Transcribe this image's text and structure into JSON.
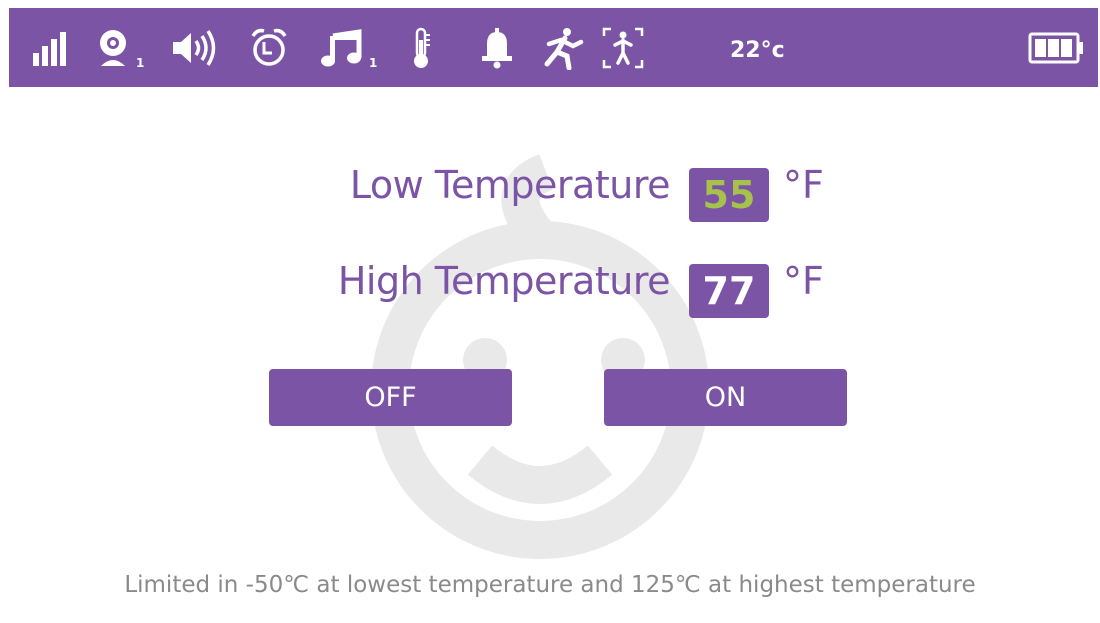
{
  "status_bar": {
    "icons": [
      "signal-icon",
      "camera-icon",
      "volume-icon",
      "alarm-clock-icon",
      "music-icon",
      "thermometer-icon",
      "bell-icon",
      "motion-icon",
      "person-frame-icon",
      "battery-icon"
    ],
    "camera_index": "1",
    "music_index": "1",
    "temperature": "22°c",
    "battery_level": 1.0
  },
  "settings": {
    "low_label": "Low Temperature",
    "low_value": "55",
    "low_unit": "°F",
    "high_label": "High Temperature",
    "high_value": "77",
    "high_unit": "°F"
  },
  "buttons": {
    "off_label": "OFF",
    "on_label": "ON"
  },
  "note": "Limited in -50℃ at lowest temperature and 125℃ at highest temperature",
  "colors": {
    "accent": "#7b54a5",
    "low_value_text": "#a6c24a",
    "high_value_text": "#ffffff",
    "note_text": "#8a8a8a"
  }
}
